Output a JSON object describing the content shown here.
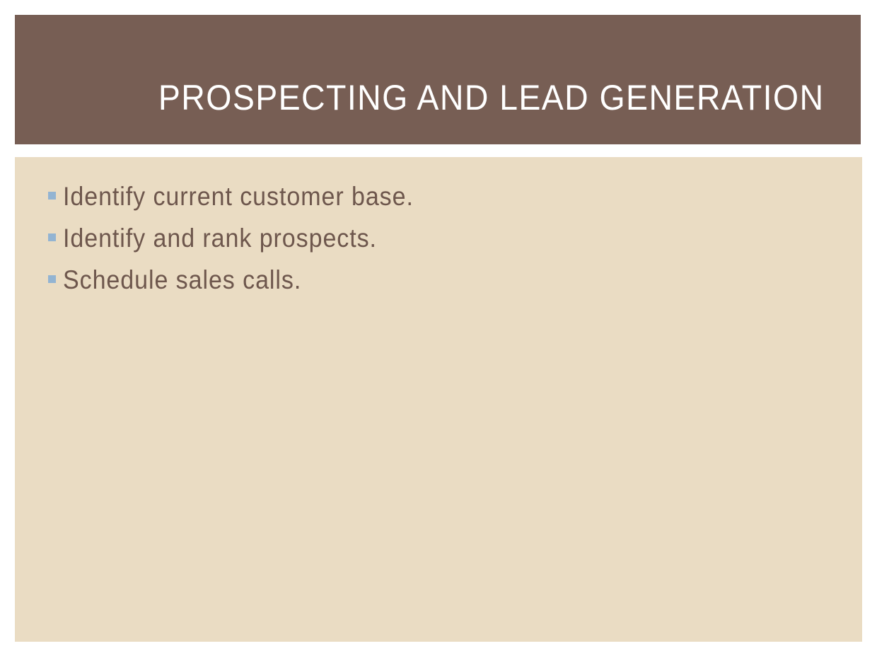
{
  "slide": {
    "title": "PROSPECTING AND LEAD GENERATION",
    "bullets": [
      "Identify current customer base.",
      "Identify and rank prospects.",
      "Schedule sales calls."
    ]
  },
  "colors": {
    "title_bar": "#775e54",
    "content_bg": "#eadcc3",
    "bullet_marker": "#93b4d2",
    "bullet_text": "#6e574d",
    "title_text": "#ffffff"
  }
}
